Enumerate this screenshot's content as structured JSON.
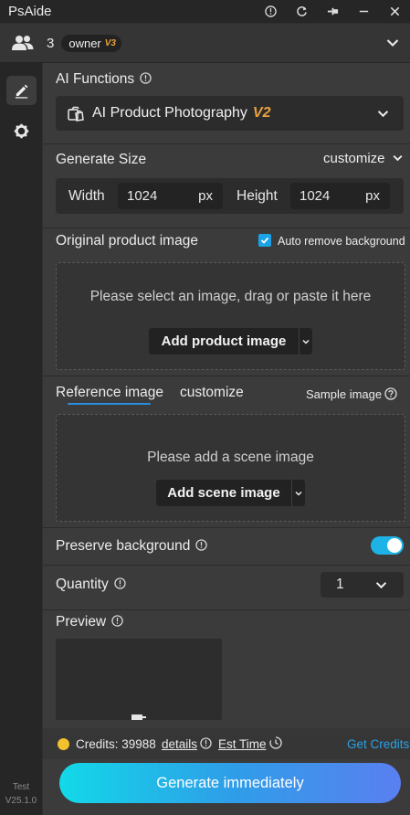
{
  "window": {
    "title": "PsAide"
  },
  "team": {
    "count": "3",
    "role": "owner",
    "role_version": "V3"
  },
  "sidebar": {
    "edit_icon": "pencil-icon",
    "settings_icon": "gear-icon",
    "env": "Test",
    "version": "V25.1.0"
  },
  "ai_functions": {
    "label": "AI Functions",
    "selected": "AI Product Photography",
    "selected_version": "V2"
  },
  "generate_size": {
    "label": "Generate Size",
    "mode": "customize",
    "width_label": "Width",
    "width_value": "1024",
    "height_label": "Height",
    "height_value": "1024",
    "unit": "px"
  },
  "original_image": {
    "label": "Original product image",
    "auto_remove_label": "Auto remove background",
    "auto_remove_checked": true,
    "drop_text": "Please select an image, drag or paste it here",
    "add_button": "Add product image"
  },
  "reference": {
    "tab_reference": "Reference image",
    "tab_customize": "customize",
    "active_tab": "Reference image",
    "sample_label": "Sample image",
    "drop_text": "Please add a scene image",
    "add_button": "Add scene image"
  },
  "preserve_background": {
    "label": "Preserve background",
    "enabled": true
  },
  "quantity": {
    "label": "Quantity",
    "value": "1"
  },
  "preview": {
    "label": "Preview"
  },
  "credits": {
    "label": "Credits: 39988",
    "details": "details",
    "est_time": "Est Time",
    "get_credits": "Get Credits"
  },
  "generate_button": "Generate immediately",
  "colors": {
    "accent": "#1eb3e6",
    "version_badge": "#e9a23b",
    "link": "#2aa2e6"
  }
}
